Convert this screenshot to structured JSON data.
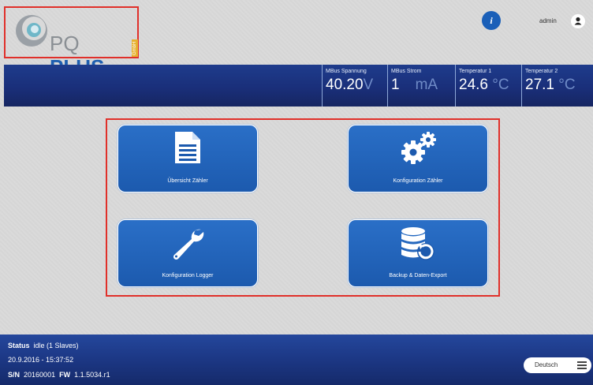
{
  "header": {
    "logo": {
      "name_part1": "PQ",
      "name_part2": "PLUS",
      "suffix": "GmbH"
    },
    "info_icon_label": "i",
    "user": {
      "name": "admin"
    }
  },
  "measurements": [
    {
      "label": "MBus Spannung",
      "value": "40.20",
      "unit": "V"
    },
    {
      "label": "MBus Strom",
      "value": "1",
      "unit": "mA"
    },
    {
      "label": "Temperatur 1",
      "value": "24.6",
      "unit": "°C"
    },
    {
      "label": "Temperatur 2",
      "value": "27.1",
      "unit": "°C"
    }
  ],
  "menu": {
    "tiles": [
      {
        "label": "Übersicht Zähler",
        "icon": "document-icon"
      },
      {
        "label": "Konfiguration Zähler",
        "icon": "gears-icon"
      },
      {
        "label": "Konfiguration Logger",
        "icon": "wrench-icon"
      },
      {
        "label": "Backup & Daten-Export",
        "icon": "database-restore-icon"
      }
    ]
  },
  "footer": {
    "status_label": "Status",
    "status_value": "idle  (1 Slaves)",
    "datetime": "20.9.2016 - 15:37:52",
    "sn_label": "S/N",
    "sn_value": "20160001",
    "fw_label": "FW",
    "fw_value": "1.1.5034.r1",
    "language": "Deutsch"
  },
  "colors": {
    "accent": "#1c5aae",
    "highlight_border": "#e0302a",
    "bar_dark": "#162662"
  }
}
